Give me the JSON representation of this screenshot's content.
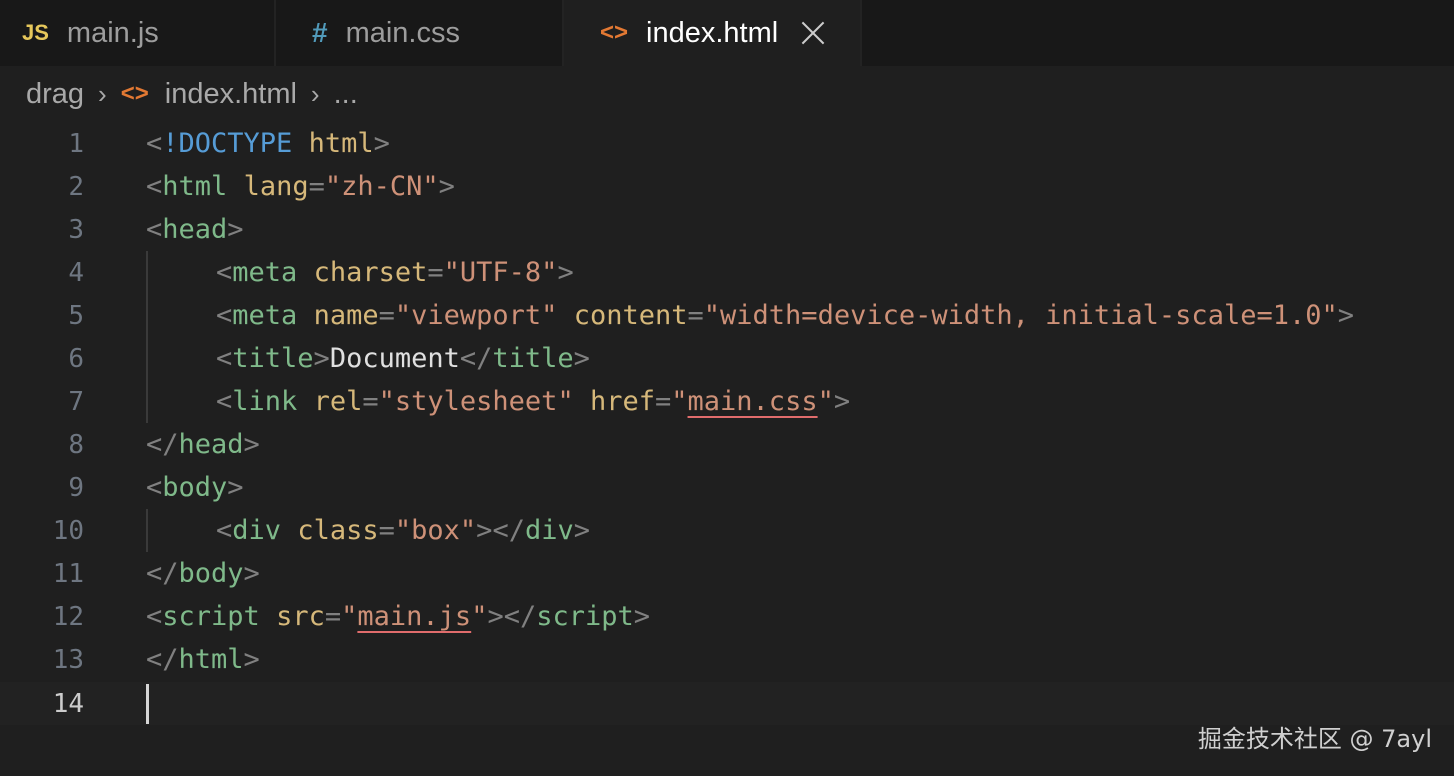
{
  "tabs": [
    {
      "icon": "JS",
      "label": "main.js"
    },
    {
      "icon": "#",
      "label": "main.css"
    },
    {
      "icon": "<>",
      "label": "index.html"
    }
  ],
  "breadcrumb": {
    "folder": "drag",
    "icon": "<>",
    "file": "index.html",
    "more": "..."
  },
  "editor": {
    "current_line": 14,
    "line_numbers": [
      "1",
      "2",
      "3",
      "4",
      "5",
      "6",
      "7",
      "8",
      "9",
      "10",
      "11",
      "12",
      "13",
      "14"
    ]
  },
  "code": {
    "l1": {
      "open": "<",
      "name": "!DOCTYPE",
      "sp": " ",
      "val": "html",
      "close": ">"
    },
    "l2": {
      "open": "<",
      "name": "html",
      "sp": " ",
      "attr": "lang",
      "eq": "=",
      "q1": "\"",
      "val": "zh-CN",
      "q2": "\"",
      "close": ">"
    },
    "l3": {
      "open": "<",
      "name": "head",
      "close": ">"
    },
    "l4": {
      "open": "<",
      "name": "meta",
      "sp": " ",
      "attr": "charset",
      "eq": "=",
      "q1": "\"",
      "val": "UTF-8",
      "q2": "\"",
      "close": ">"
    },
    "l5": {
      "open": "<",
      "name": "meta",
      "sp": " ",
      "attr1": "name",
      "eq1": "=",
      "q1": "\"",
      "val1": "viewport",
      "q2": "\"",
      "sp2": " ",
      "attr2": "content",
      "eq2": "=",
      "q3": "\"",
      "val2": "width=device-width, initial-scale=1.0",
      "q4": "\"",
      "close": ">"
    },
    "l6": {
      "open": "<",
      "name": "title",
      "close": ">",
      "text": "Document",
      "open2": "</",
      "name2": "title",
      "close2": ">"
    },
    "l7": {
      "open": "<",
      "name": "link",
      "sp": " ",
      "attr1": "rel",
      "eq1": "=",
      "q1": "\"",
      "val1": "stylesheet",
      "q2": "\"",
      "sp2": " ",
      "attr2": "href",
      "eq2": "=",
      "q3": "\"",
      "val2": "main.css",
      "q4": "\"",
      "close": ">"
    },
    "l8": {
      "open": "</",
      "name": "head",
      "close": ">"
    },
    "l9": {
      "open": "<",
      "name": "body",
      "close": ">"
    },
    "l10": {
      "open": "<",
      "name": "div",
      "sp": " ",
      "attr": "class",
      "eq": "=",
      "q1": "\"",
      "val": "box",
      "q2": "\"",
      "close": ">",
      "open2": "</",
      "name2": "div",
      "close2": ">"
    },
    "l11": {
      "open": "</",
      "name": "body",
      "close": ">"
    },
    "l12": {
      "open": "<",
      "name": "script",
      "sp": " ",
      "attr": "src",
      "eq": "=",
      "q1": "\"",
      "val": "main.js",
      "q2": "\"",
      "close": ">",
      "open2": "</",
      "name2": "script",
      "close2": ">"
    },
    "l13": {
      "open": "</",
      "name": "html",
      "close": ">"
    }
  },
  "watermark": "掘金技术社区 @ 7ayl"
}
